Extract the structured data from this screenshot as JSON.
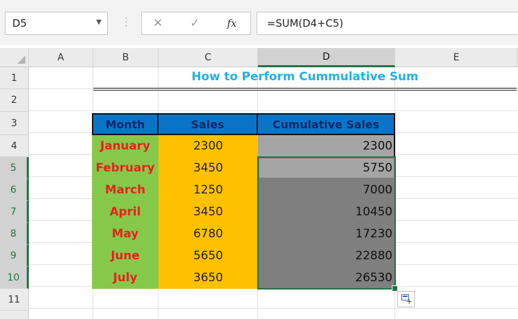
{
  "formula_bar": {
    "name_box": "D5",
    "dropdown_icon": "chevron-down-icon",
    "separator": "⋮",
    "cancel_glyph": "✕",
    "enter_glyph": "✓",
    "fx_glyph": "fx",
    "formula": "=SUM(D4+C5)"
  },
  "columns": [
    "A",
    "B",
    "C",
    "D",
    "E"
  ],
  "rows": [
    "1",
    "2",
    "3",
    "4",
    "5",
    "6",
    "7",
    "8",
    "9",
    "10",
    "11"
  ],
  "sheet": {
    "title": "How to Perform Cummulative Sum",
    "headers": [
      "Month",
      "Sales",
      "Cumulative Sales"
    ],
    "data": [
      {
        "month": "January",
        "sales": "2300",
        "cumulative": "2300"
      },
      {
        "month": "February",
        "sales": "3450",
        "cumulative": "5750"
      },
      {
        "month": "March",
        "sales": "1250",
        "cumulative": "7000"
      },
      {
        "month": "April",
        "sales": "3450",
        "cumulative": "10450"
      },
      {
        "month": "May",
        "sales": "6780",
        "cumulative": "17230"
      },
      {
        "month": "June",
        "sales": "5650",
        "cumulative": "22880"
      },
      {
        "month": "July",
        "sales": "3650",
        "cumulative": "26530"
      }
    ]
  },
  "colors": {
    "title": "#1fb0e8",
    "header_fill": "#0b74c6",
    "month_fill": "#86c94a",
    "month_text": "#e8211e",
    "sales_fill": "#ffc000",
    "selection": "#217346"
  }
}
